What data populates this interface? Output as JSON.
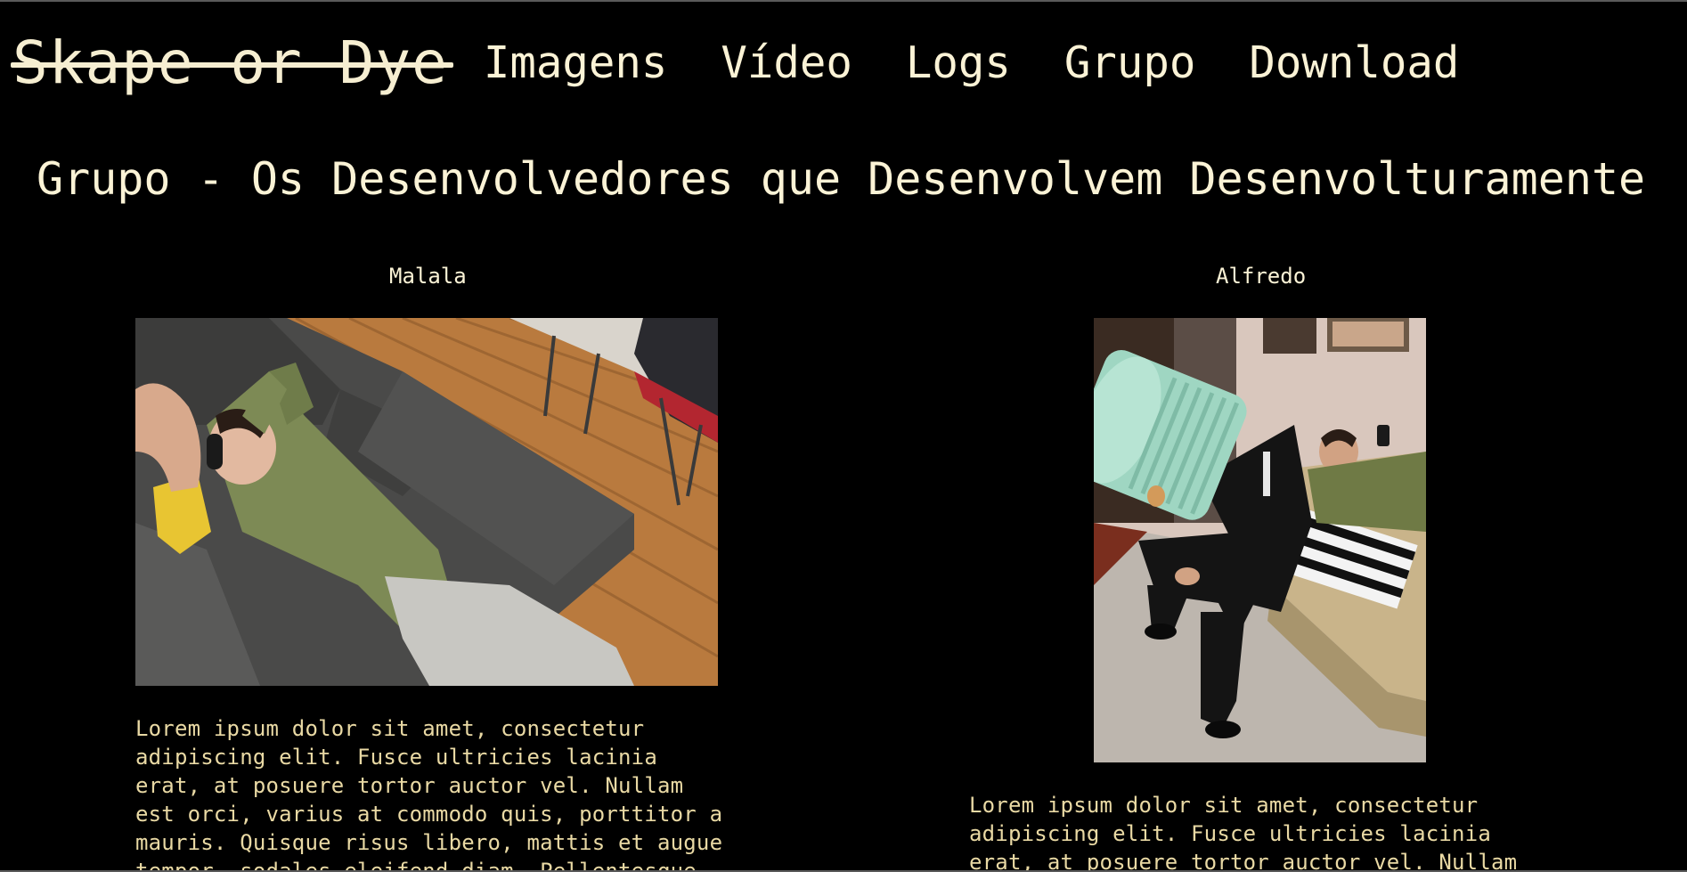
{
  "site": {
    "logo": "Skape or Dye"
  },
  "nav": {
    "links": [
      "Imagens",
      "Vídeo",
      "Logs",
      "Grupo",
      "Download"
    ]
  },
  "page": {
    "title": "Grupo - Os Desenvolvedores que Desenvolvem Desenvolturamente"
  },
  "members": [
    {
      "name": "Malala",
      "bio": "Lorem ipsum dolor sit amet, consectetur adipiscing elit. Fusce ultricies lacinia erat, at posuere tortor auctor vel. Nullam est orci, varius at commodo quis, porttitor a mauris. Quisque risus libero, mattis et augue tempor, sodales eleifend diam. Pellentesque"
    },
    {
      "name": "Alfredo",
      "bio": "Lorem ipsum dolor sit amet, consectetur adipiscing elit. Fusce ultricies lacinia erat, at posuere tortor auctor vel. Nullam"
    }
  ],
  "colors": {
    "background": "#000000",
    "text": "#fbf3d6",
    "bio_text": "#e9d9a4"
  }
}
